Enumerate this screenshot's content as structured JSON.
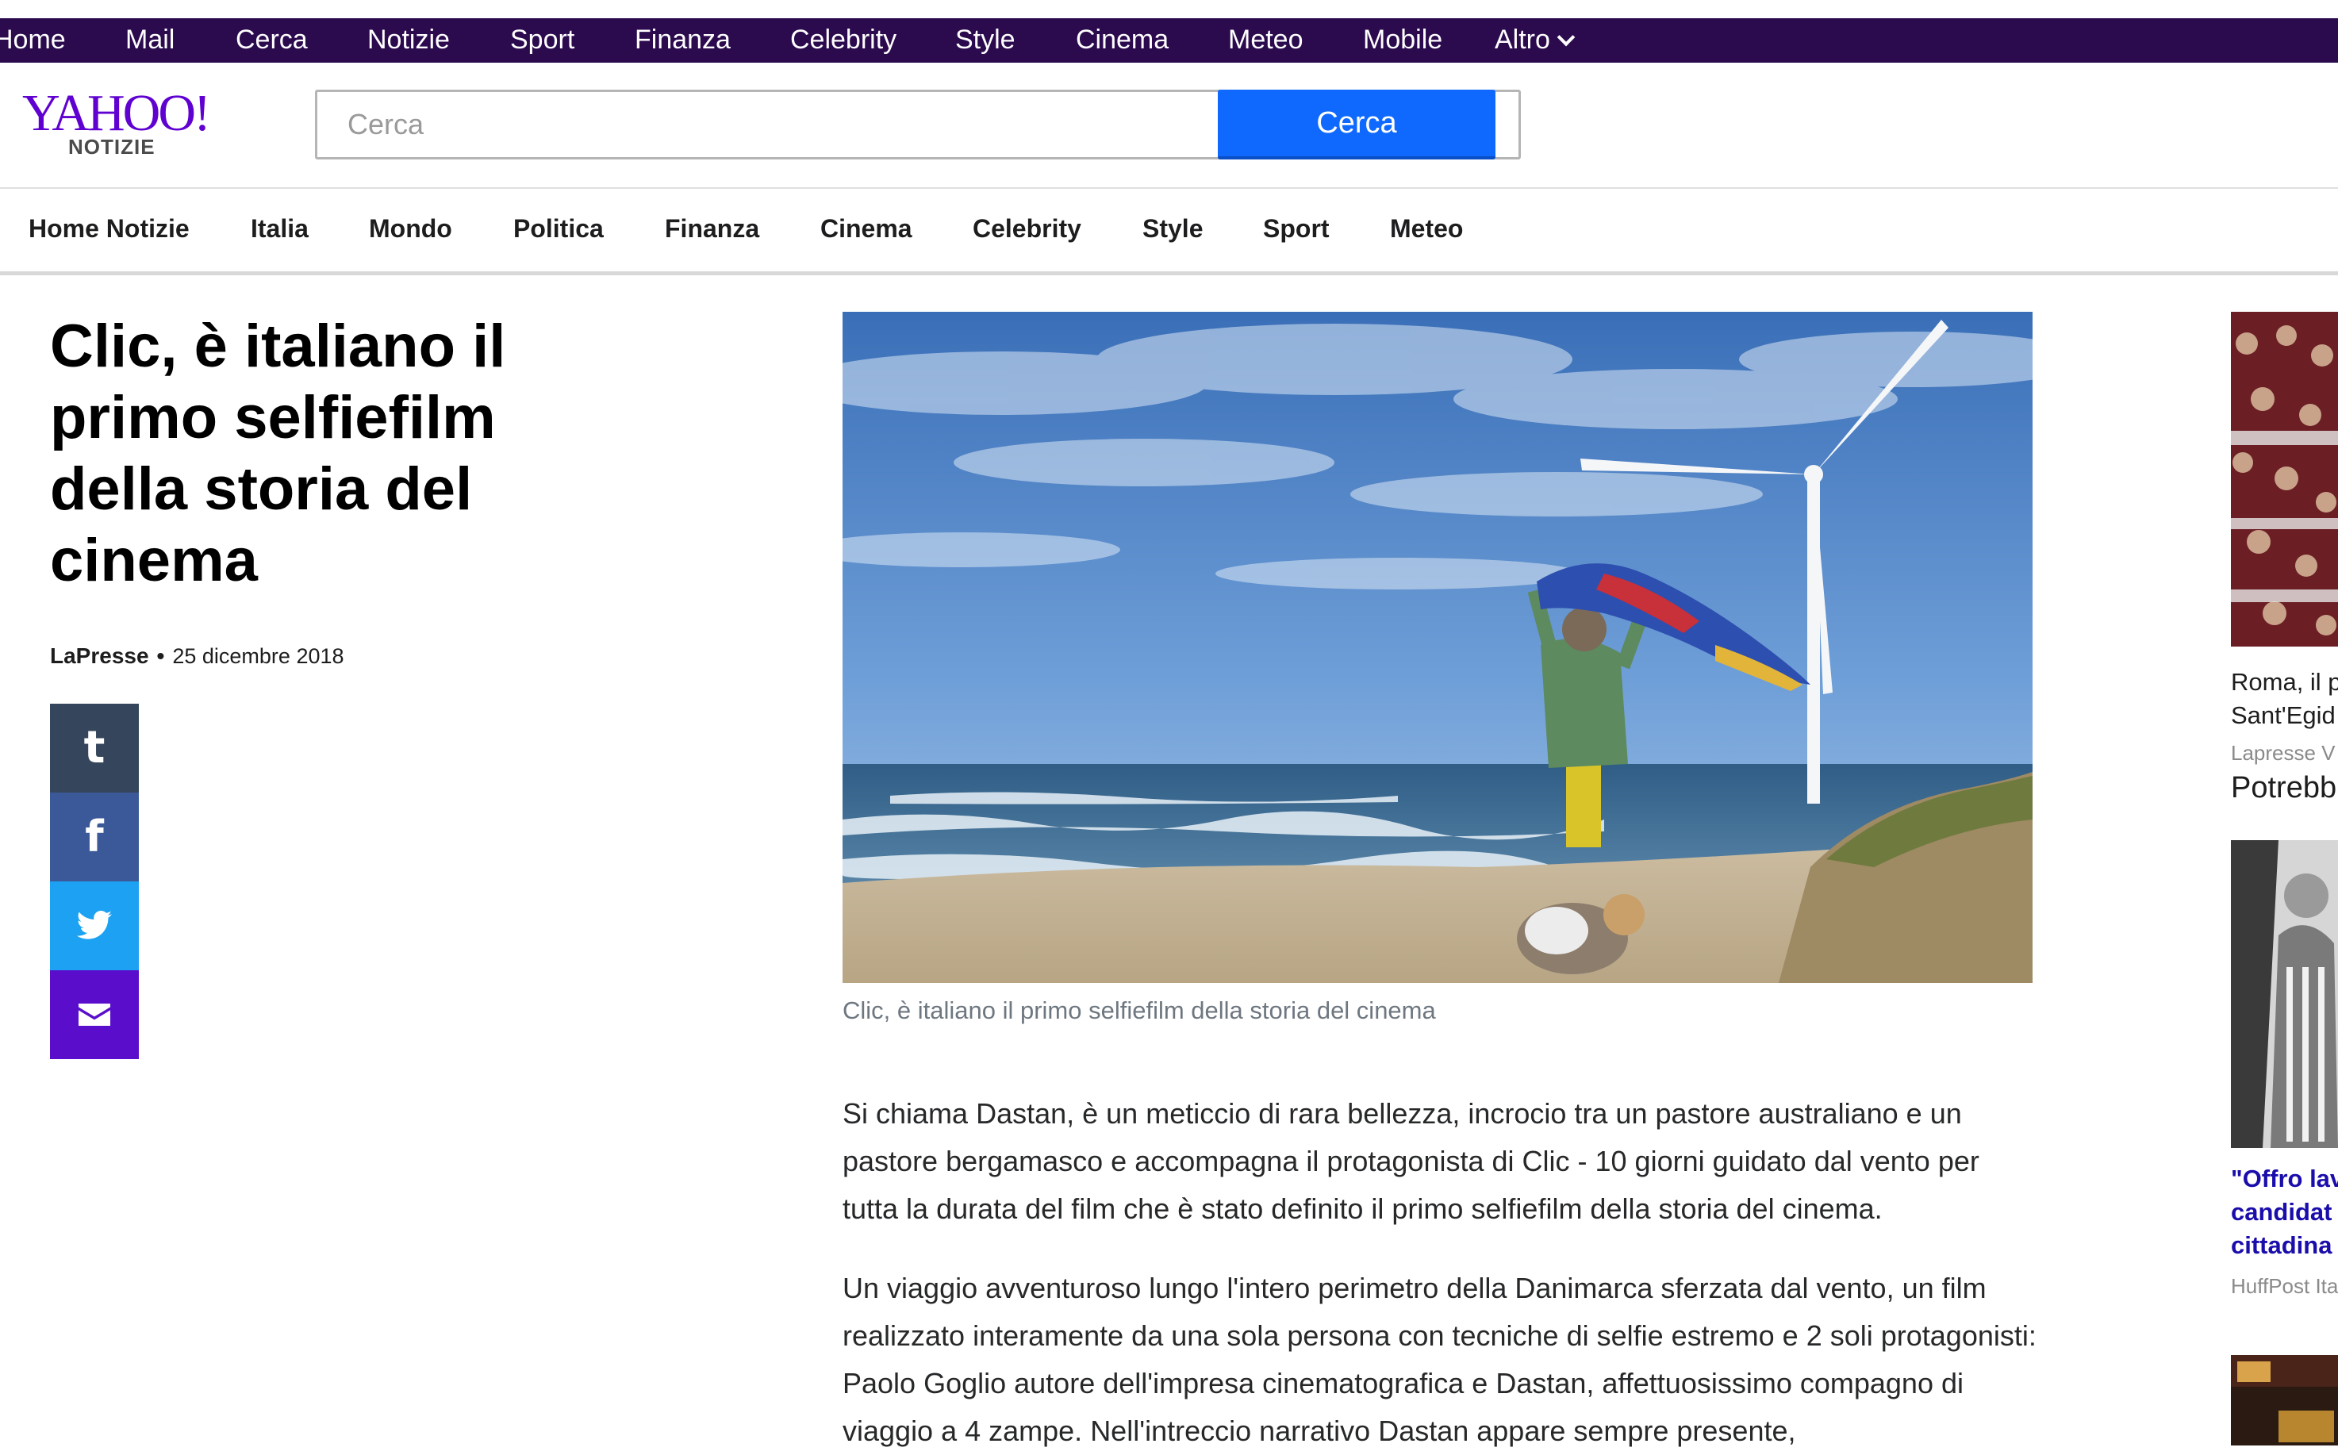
{
  "topnav": {
    "items": [
      "Home",
      "Mail",
      "Cerca",
      "Notizie",
      "Sport",
      "Finanza",
      "Celebrity",
      "Style",
      "Cinema",
      "Meteo",
      "Mobile",
      "Altro"
    ]
  },
  "header": {
    "logo_main": "YAHOO!",
    "logo_sub": "NOTIZIE",
    "search_placeholder": "Cerca",
    "search_button": "Cerca"
  },
  "secnav": {
    "items": [
      "Home Notizie",
      "Italia",
      "Mondo",
      "Politica",
      "Finanza",
      "Cinema",
      "Celebrity",
      "Style",
      "Sport",
      "Meteo"
    ]
  },
  "article": {
    "title": "Clic, è italiano il primo selfiefilm della storia del cinema",
    "source": "LaPresse",
    "date": "25 dicembre 2018",
    "image_caption": "Clic, è italiano il primo selfiefilm della storia del cinema",
    "paragraphs": [
      "Si chiama Dastan, è un meticcio di rara bellezza, incrocio tra un pastore australiano e un pastore bergamasco e accompagna il protagonista di Clic - 10 giorni guidato dal vento per tutta la durata del film che è stato definito il primo selfiefilm della storia del cinema.",
      "Un viaggio avventuroso lungo l'intero perimetro della Danimarca sferzata dal vento, un film realizzato interamente da una sola persona con tecniche di selfie estremo e 2 soli protagonisti: Paolo Goglio autore dell'impresa cinematografica e Dastan, affettuosissimo compagno di viaggio a 4 zampe. Nell'intreccio narrativo Dastan appare sempre presente,"
    ]
  },
  "share": {
    "tumblr_glyph": "t",
    "facebook_glyph": "f",
    "colors": {
      "tumblr": "#35465c",
      "facebook": "#3b5998",
      "twitter": "#1da1f2",
      "email": "#5a0ecc"
    }
  },
  "rail": {
    "item1_line1": "Roma, il p",
    "item1_line2": "Sant'Egid",
    "item1_source": "Lapresse V",
    "section_heading": "Potrebb",
    "item2_line1": "\"Offro lav",
    "item2_line2": "candidat",
    "item2_line3": "cittadina",
    "item2_source": "HuffPost Ita"
  },
  "colors": {
    "topnav_bg": "#2b0a4e",
    "brand_purple": "#5f01d1",
    "search_blue": "#0f69ff",
    "rail_link": "#1a0dab"
  }
}
